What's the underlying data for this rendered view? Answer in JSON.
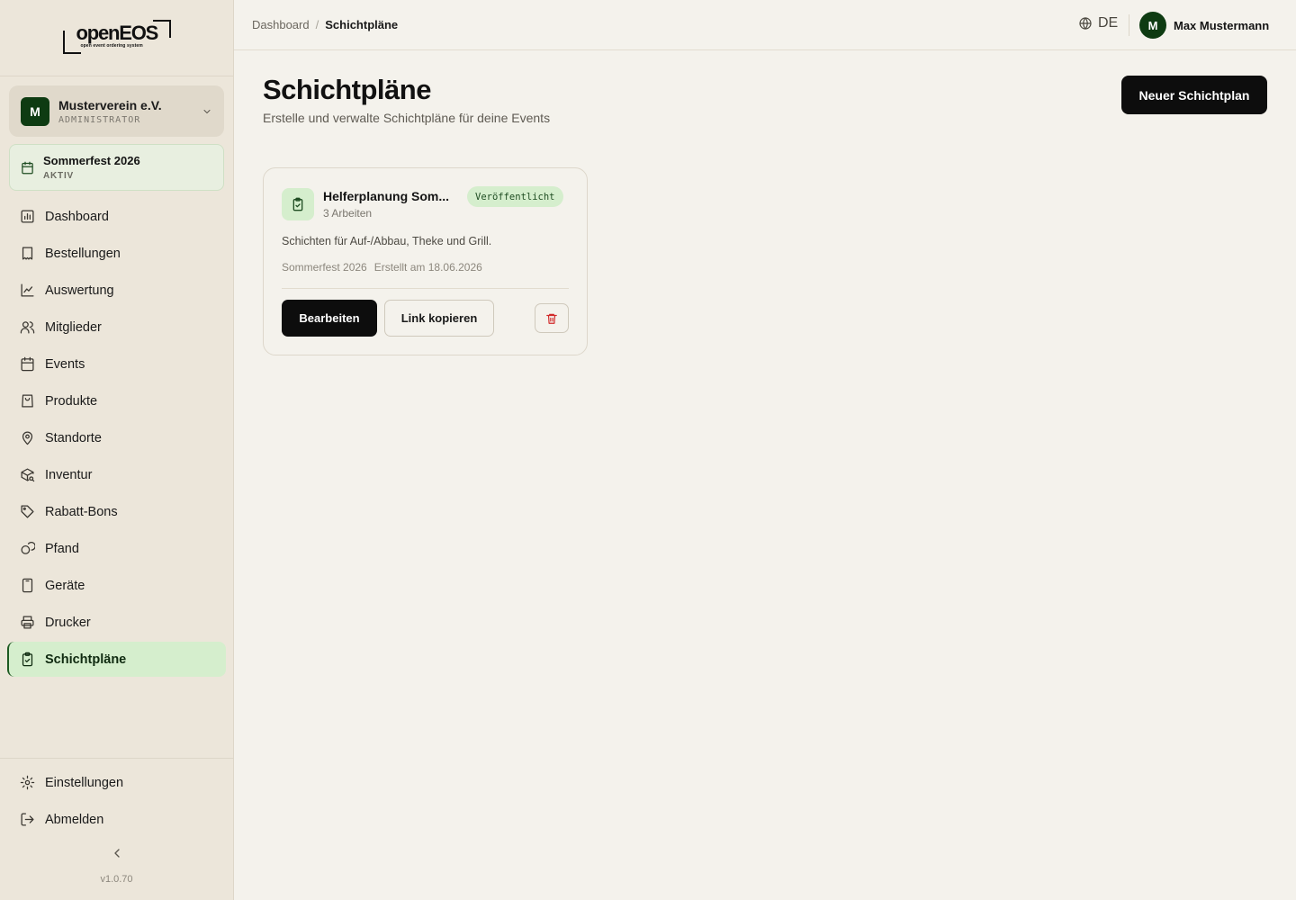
{
  "logo": {
    "wordmark": "openEOS",
    "tagline": "open event ordering system"
  },
  "org": {
    "initial": "M",
    "name": "Musterverein e.V.",
    "role": "ADMINISTRATOR"
  },
  "event": {
    "name": "Sommerfest 2026",
    "status": "AKTIV"
  },
  "nav": {
    "items": [
      {
        "label": "Dashboard",
        "icon": "chart-icon"
      },
      {
        "label": "Bestellungen",
        "icon": "receipt-icon"
      },
      {
        "label": "Auswertung",
        "icon": "trend-icon"
      },
      {
        "label": "Mitglieder",
        "icon": "users-icon"
      },
      {
        "label": "Events",
        "icon": "calendar-icon"
      },
      {
        "label": "Produkte",
        "icon": "shopping-bag-icon"
      },
      {
        "label": "Standorte",
        "icon": "map-pin-icon"
      },
      {
        "label": "Inventur",
        "icon": "package-search-icon"
      },
      {
        "label": "Rabatt-Bons",
        "icon": "tag-icon"
      },
      {
        "label": "Pfand",
        "icon": "coins-icon"
      },
      {
        "label": "Geräte",
        "icon": "tablet-icon"
      },
      {
        "label": "Drucker",
        "icon": "printer-icon"
      },
      {
        "label": "Schichtpläne",
        "icon": "clipboard-check-icon",
        "active": true
      }
    ],
    "settings": "Einstellungen",
    "logout": "Abmelden"
  },
  "version": "v1.0.70",
  "breadcrumb": {
    "parent": "Dashboard",
    "separator": "/",
    "current": "Schichtpläne"
  },
  "language": "DE",
  "user": {
    "initial": "M",
    "name": "Max Mustermann"
  },
  "page": {
    "title": "Schichtpläne",
    "subtitle": "Erstelle und verwalte Schichtpläne für deine Events",
    "new_button": "Neuer Schichtplan"
  },
  "plan": {
    "title": "Helferplanung Som...",
    "count": "3 Arbeiten",
    "status": "Veröffentlicht",
    "description": "Schichten für Auf-/Abbau, Theke und Grill.",
    "event": "Sommerfest 2026",
    "created": "Erstellt am 18.06.2026",
    "edit_label": "Bearbeiten",
    "copy_label": "Link kopieren"
  },
  "colors": {
    "accent": "#0e3b12",
    "active_bg": "#d5eecd",
    "danger": "#d12a2a"
  }
}
